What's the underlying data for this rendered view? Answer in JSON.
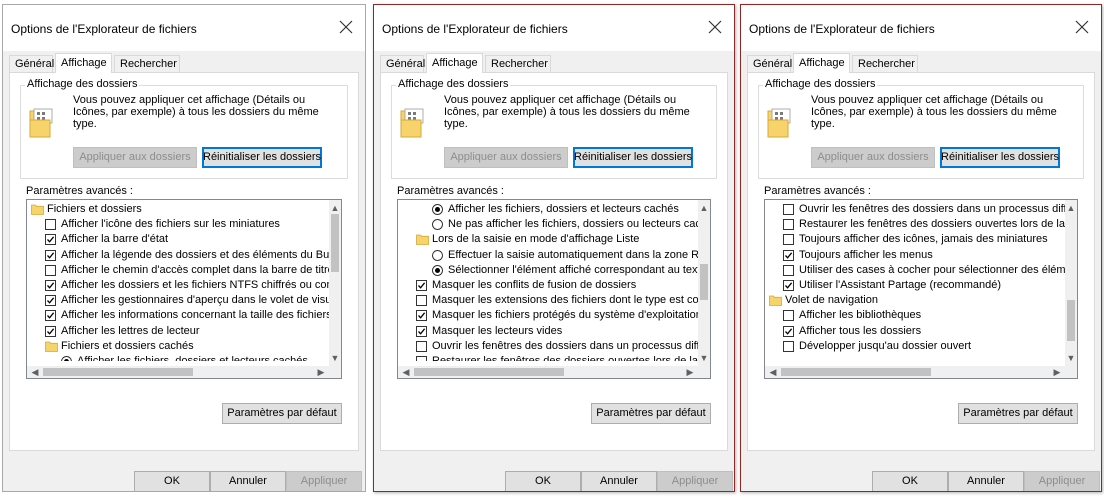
{
  "dialogs": [
    {
      "title": "Options de l'Explorateur de fichiers",
      "tabs": [
        "Général",
        "Affichage",
        "Rechercher"
      ],
      "active_tab": 1,
      "group_title": "Affichage des dossiers",
      "group_desc": "Vous pouvez appliquer cet affichage (Détails ou Icônes, par exemple) à tous les dossiers du même type.",
      "apply_folders": "Appliquer aux dossiers",
      "reset_folders": "Réinitialiser les dossiers",
      "advanced_label": "Paramètres avancés :",
      "rows": [
        {
          "type": "folder",
          "indent": 0,
          "label": "Fichiers et dossiers"
        },
        {
          "type": "checkbox",
          "indent": 1,
          "checked": false,
          "label": "Afficher l'icône des fichiers sur les miniatures"
        },
        {
          "type": "checkbox",
          "indent": 1,
          "checked": true,
          "label": "Afficher la barre d'état"
        },
        {
          "type": "checkbox",
          "indent": 1,
          "checked": true,
          "label": "Afficher la légende des dossiers et des éléments du Bureau"
        },
        {
          "type": "checkbox",
          "indent": 1,
          "checked": false,
          "label": "Afficher le chemin d'accès complet dans la barre de titre"
        },
        {
          "type": "checkbox",
          "indent": 1,
          "checked": true,
          "label": "Afficher les dossiers et les fichiers NTFS chiffrés ou compressés en couleur"
        },
        {
          "type": "checkbox",
          "indent": 1,
          "checked": true,
          "label": "Afficher les gestionnaires d'aperçu dans le volet de visualisation"
        },
        {
          "type": "checkbox",
          "indent": 1,
          "checked": true,
          "label": "Afficher les informations concernant la taille des fichiers dans les info-bulles des dossiers"
        },
        {
          "type": "checkbox",
          "indent": 1,
          "checked": true,
          "label": "Afficher les lettres de lecteur"
        },
        {
          "type": "folder",
          "indent": 1,
          "label": "Fichiers et dossiers cachés"
        },
        {
          "type": "radio",
          "indent": 2,
          "checked": true,
          "label": "Afficher les fichiers, dossiers et lecteurs cachés"
        }
      ],
      "scroll_thumb": {
        "top": 0.0,
        "size": 0.42
      },
      "defaults_button": "Paramètres par défaut",
      "ok": "OK",
      "cancel": "Annuler",
      "apply": "Appliquer"
    },
    {
      "title": "Options de l'Explorateur de fichiers",
      "tabs": [
        "Général",
        "Affichage",
        "Rechercher"
      ],
      "active_tab": 1,
      "group_title": "Affichage des dossiers",
      "group_desc": "Vous pouvez appliquer cet affichage (Détails ou Icônes, par exemple) à tous les dossiers du même type.",
      "apply_folders": "Appliquer aux dossiers",
      "reset_folders": "Réinitialiser les dossiers",
      "advanced_label": "Paramètres avancés :",
      "rows": [
        {
          "type": "radio",
          "indent": 2,
          "checked": true,
          "label": "Afficher les fichiers, dossiers et lecteurs cachés"
        },
        {
          "type": "radio",
          "indent": 2,
          "checked": false,
          "label": "Ne pas afficher les fichiers, dossiers ou lecteurs cachés"
        },
        {
          "type": "folder",
          "indent": 1,
          "label": "Lors de la saisie en mode d'affichage Liste"
        },
        {
          "type": "radio",
          "indent": 2,
          "checked": false,
          "label": "Effectuer la saisie automatiquement dans la zone Recherche"
        },
        {
          "type": "radio",
          "indent": 2,
          "checked": true,
          "label": "Sélectionner l'élément affiché correspondant au texte saisi"
        },
        {
          "type": "checkbox",
          "indent": 1,
          "checked": true,
          "label": "Masquer les conflits de fusion de dossiers"
        },
        {
          "type": "checkbox",
          "indent": 1,
          "checked": false,
          "label": "Masquer les extensions des fichiers dont le type est connu"
        },
        {
          "type": "checkbox",
          "indent": 1,
          "checked": true,
          "label": "Masquer les fichiers protégés du système d'exploitation (recommandé)"
        },
        {
          "type": "checkbox",
          "indent": 1,
          "checked": true,
          "label": "Masquer les lecteurs vides"
        },
        {
          "type": "checkbox",
          "indent": 1,
          "checked": false,
          "label": "Ouvrir les fenêtres des dossiers dans un processus différent"
        },
        {
          "type": "checkbox",
          "indent": 1,
          "checked": false,
          "label": "Restaurer les fenêtres des dossiers ouvertes lors de la prochaine ouverture de session"
        }
      ],
      "scroll_thumb": {
        "top": 0.36,
        "size": 0.26
      },
      "defaults_button": "Paramètres par défaut",
      "ok": "OK",
      "cancel": "Annuler",
      "apply": "Appliquer"
    },
    {
      "title": "Options de l'Explorateur de fichiers",
      "tabs": [
        "Général",
        "Affichage",
        "Rechercher"
      ],
      "active_tab": 1,
      "group_title": "Affichage des dossiers",
      "group_desc": "Vous pouvez appliquer cet affichage (Détails ou Icônes, par exemple) à tous les dossiers du même type.",
      "apply_folders": "Appliquer aux dossiers",
      "reset_folders": "Réinitialiser les dossiers",
      "advanced_label": "Paramètres avancés :",
      "rows": [
        {
          "type": "checkbox",
          "indent": 1,
          "checked": false,
          "label": "Ouvrir les fenêtres des dossiers dans un processus différent"
        },
        {
          "type": "checkbox",
          "indent": 1,
          "checked": false,
          "label": "Restaurer les fenêtres des dossiers ouvertes lors de la prochaine ouverture de session"
        },
        {
          "type": "checkbox",
          "indent": 1,
          "checked": false,
          "label": "Toujours afficher des icônes, jamais des miniatures"
        },
        {
          "type": "checkbox",
          "indent": 1,
          "checked": true,
          "label": "Toujours afficher les menus"
        },
        {
          "type": "checkbox",
          "indent": 1,
          "checked": false,
          "label": "Utiliser des cases à cocher pour sélectionner des éléments"
        },
        {
          "type": "checkbox",
          "indent": 1,
          "checked": true,
          "label": "Utiliser l'Assistant Partage (recommandé)"
        },
        {
          "type": "folder",
          "indent": 0,
          "label": "Volet de navigation"
        },
        {
          "type": "checkbox",
          "indent": 1,
          "checked": false,
          "label": "Afficher les bibliothèques"
        },
        {
          "type": "checkbox",
          "indent": 1,
          "checked": true,
          "label": "Afficher tous les dossiers"
        },
        {
          "type": "checkbox",
          "indent": 1,
          "checked": false,
          "label": "Développer jusqu'au dossier ouvert"
        }
      ],
      "scroll_thumb": {
        "top": 0.62,
        "size": 0.3
      },
      "defaults_button": "Paramètres par défaut",
      "ok": "OK",
      "cancel": "Annuler",
      "apply": "Appliquer"
    }
  ],
  "icons": {
    "close": "close-icon",
    "folder": "folder-icon",
    "check": "checkmark-icon",
    "scroll_up": "chevron-up-icon",
    "scroll_down": "chevron-down-icon",
    "scroll_left": "chevron-left-icon",
    "scroll_right": "chevron-right-icon"
  },
  "colors": {
    "dialog_bg": "#f0f0f0",
    "focus_border": "#0078d7",
    "disabled_text": "#8d8d8d",
    "folder_yellow": "#f6d36b"
  }
}
